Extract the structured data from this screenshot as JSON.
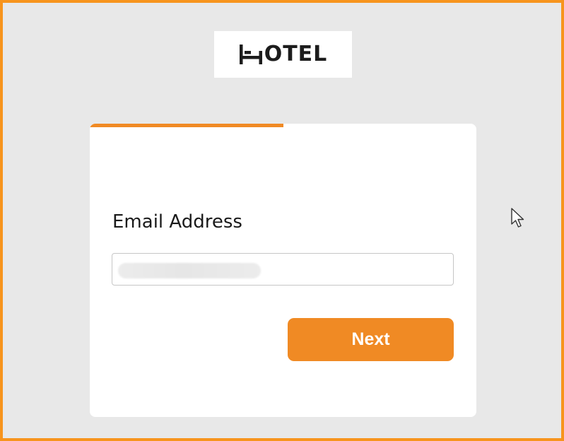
{
  "logo": {
    "text": "OTEL",
    "icon": "bed-icon"
  },
  "form": {
    "progress": 0.5,
    "email_label": "Email Address",
    "email_value": "",
    "email_placeholder": "",
    "next_label": "Next"
  },
  "colors": {
    "accent": "#f08a24",
    "frame_border": "#f7941d",
    "background": "#e8e8e8"
  }
}
